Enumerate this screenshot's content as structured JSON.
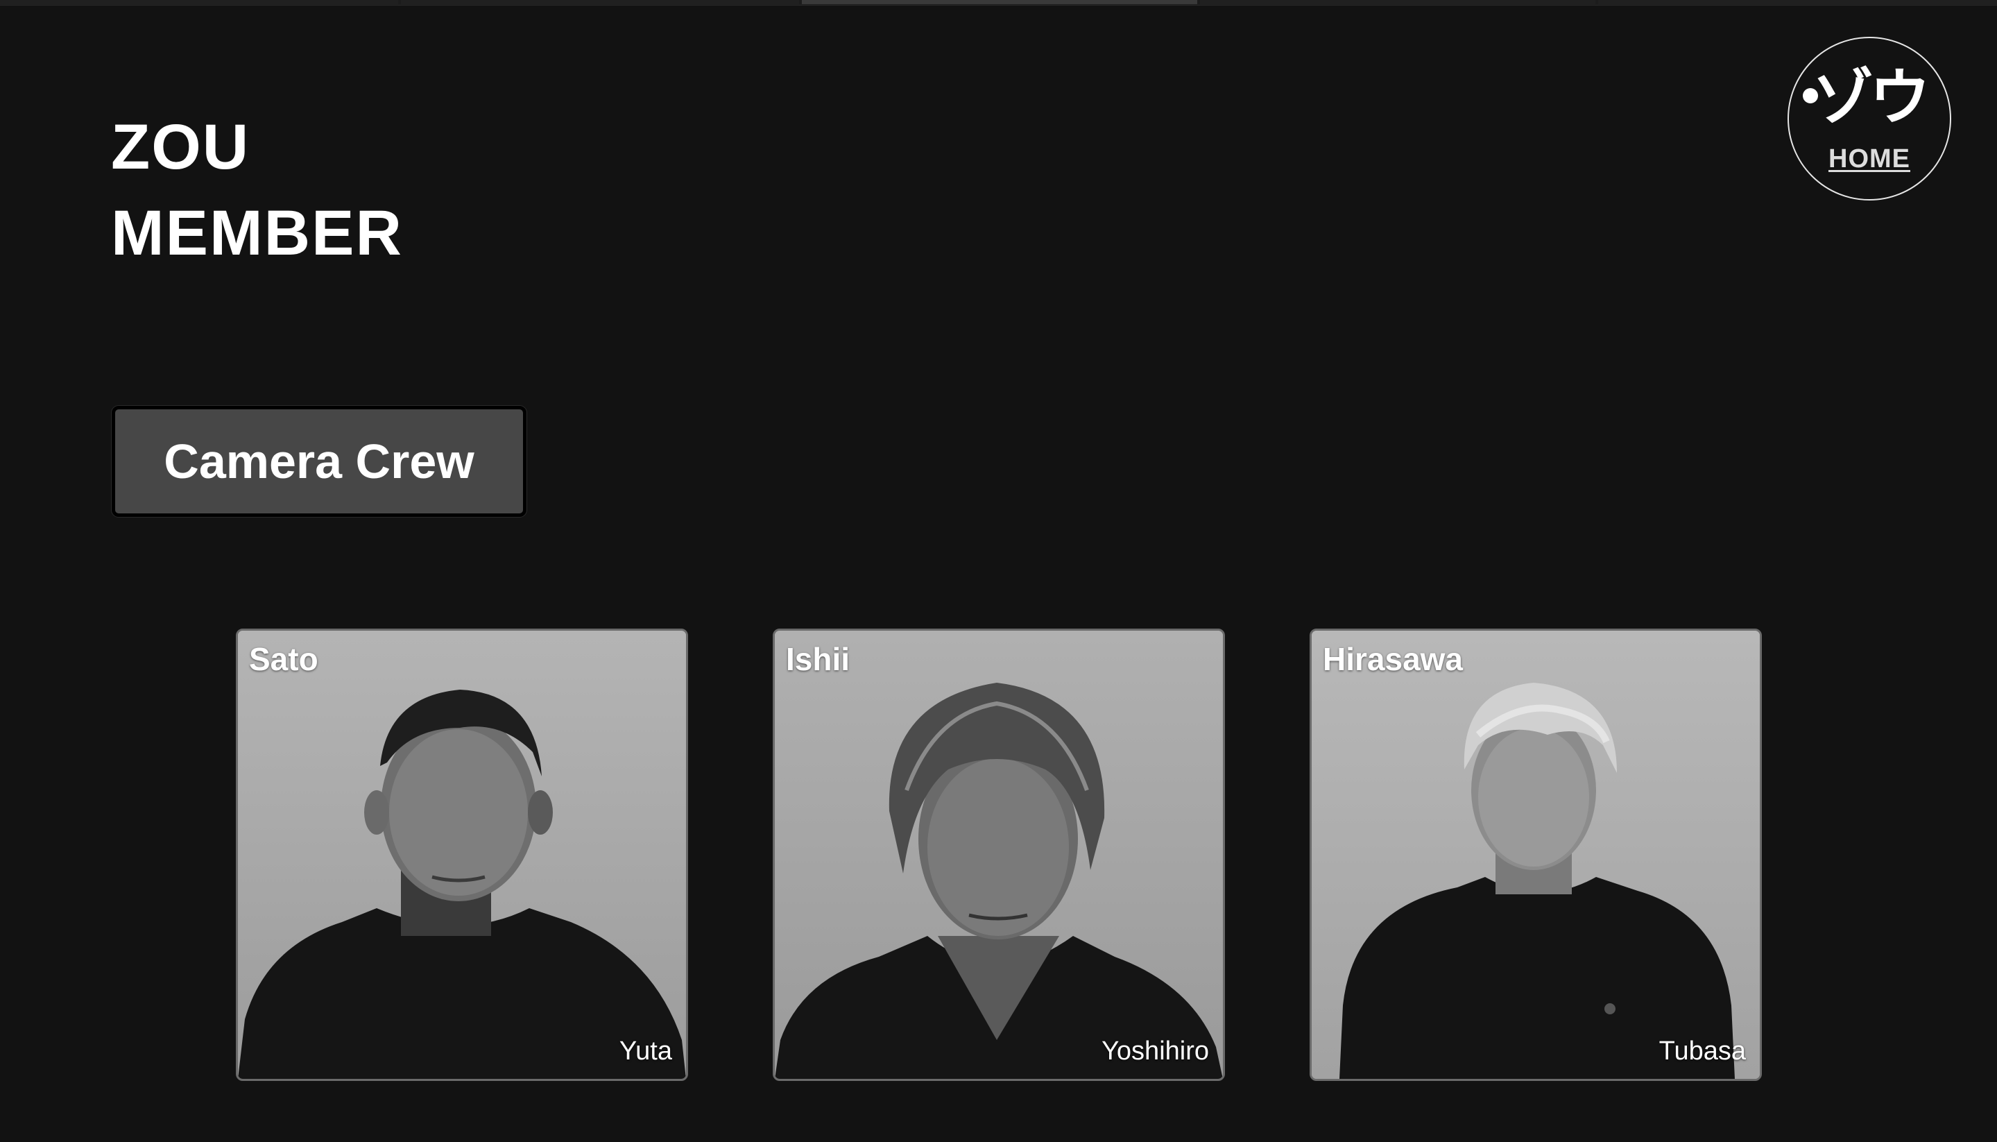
{
  "header": {
    "title_line1": "ZOU",
    "title_line2": "MEMBER"
  },
  "home_logo": {
    "kana": "ゾウ",
    "label": "HOME"
  },
  "category": {
    "label": "Camera Crew"
  },
  "members": [
    {
      "surname": "Sato",
      "given_name": "Yuta"
    },
    {
      "surname": "Ishii",
      "given_name": "Yoshihiro"
    },
    {
      "surname": "Hirasawa",
      "given_name": "Tubasa"
    }
  ],
  "colors": {
    "background": "#121212",
    "button_bg": "#474747",
    "photo_bg": "#ababab",
    "text": "#ffffff"
  }
}
